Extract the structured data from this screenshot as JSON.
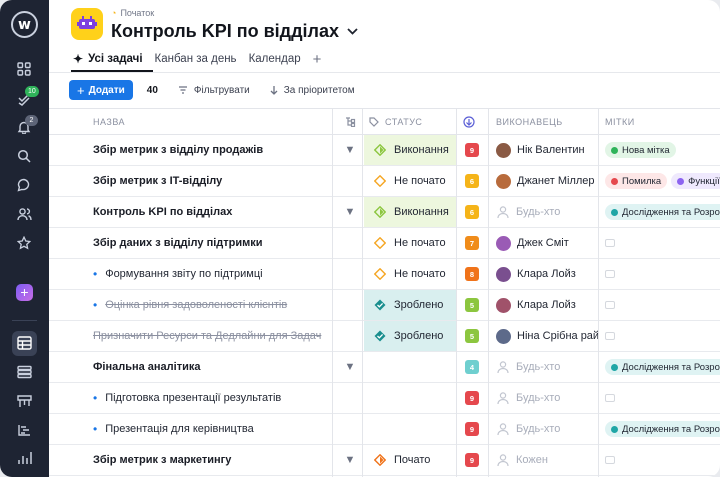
{
  "app": {
    "logo": "w"
  },
  "rail": {
    "badge_tasks": "10",
    "badge_notifications": "2"
  },
  "project": {
    "breadcrumb": "Початок",
    "title": "Контроль KPI по відділах"
  },
  "tabs": [
    {
      "label": "Усі задачі",
      "active": true
    },
    {
      "label": "Канбан за день"
    },
    {
      "label": "Календар"
    }
  ],
  "toolbar": {
    "add_label": "Додати",
    "count": "40",
    "filter_label": "Фільтрувати",
    "sort_label": "За пріоритетом"
  },
  "columns": {
    "name": "НАЗВА",
    "status": "СТАТУС",
    "assignee": "ВИКОНАВЕЦЬ",
    "tags": "МІТКИ"
  },
  "colors": {
    "accent": "#1976e6",
    "rail": "#1e2433",
    "done_green": "#edf7de",
    "done_teal": "#d9efef"
  },
  "rows": [
    {
      "name": "Збір метрик з відділу продажів",
      "level": "parent",
      "chevron": true,
      "status": "Виконання",
      "status_kind": "progress",
      "priority": "9",
      "priority_color": "#e5484d",
      "assignee": "Нік Валентин",
      "tags": [
        {
          "label": "Нова мітка",
          "bg": "#e2f5e6",
          "dot": "#2fb35a"
        }
      ]
    },
    {
      "name": "Збір метрик з IT-відділу",
      "level": "parent",
      "chevron": false,
      "status": "Не почато",
      "status_kind": "todo",
      "priority": "6",
      "priority_color": "#f5b419",
      "assignee": "Джанет Міллер",
      "tags": [
        {
          "label": "Помилка",
          "bg": "#fde7e7",
          "dot": "#e5484d"
        },
        {
          "label": "Функції",
          "bg": "#efe9fd",
          "dot": "#8c63f0"
        }
      ]
    },
    {
      "name": "Контроль KPI по відділах",
      "level": "parent",
      "chevron": true,
      "status": "Виконання",
      "status_kind": "progress",
      "priority": "6",
      "priority_color": "#f5b419",
      "assignee": "Будь-хто",
      "tags": [
        {
          "label": "Дослідження та Розробка",
          "bg": "#dff3f3",
          "dot": "#1fa6a6"
        }
      ]
    },
    {
      "name": "Збір даних з відділу підтримки",
      "level": "parent",
      "chevron": false,
      "status": "Не почато",
      "status_kind": "todo",
      "priority": "7",
      "priority_color": "#f08c1a",
      "assignee": "Джек Сміт",
      "tags": []
    },
    {
      "name": "Формування звіту по підтримці",
      "level": "child",
      "chevron": false,
      "status": "Не почато",
      "status_kind": "todo",
      "priority": "8",
      "priority_color": "#f0731a",
      "assignee": "Клара Лойз",
      "tags": []
    },
    {
      "name": "Оцінка рівня задоволеності клієнтів",
      "level": "child-done",
      "chevron": false,
      "status": "Зроблено",
      "status_kind": "done",
      "priority": "5",
      "priority_color": "#8cc63f",
      "assignee": "Клара Лойз",
      "tags": []
    },
    {
      "name": "Призначити Ресурси та Дедлайни для Задач",
      "level": "done",
      "chevron": false,
      "status": "Зроблено",
      "status_kind": "done",
      "priority": "5",
      "priority_color": "#8cc63f",
      "assignee": "Ніна Срібна райт",
      "tags": []
    },
    {
      "name": "Фінальна аналітика",
      "level": "parent",
      "chevron": true,
      "status": "",
      "status_kind": "none",
      "priority": "4",
      "priority_color": "#6fcfcf",
      "assignee": "Будь-хто",
      "tags": [
        {
          "label": "Дослідження та Розробка",
          "bg": "#dff3f3",
          "dot": "#1fa6a6"
        }
      ]
    },
    {
      "name": "Підготовка презентації результатів",
      "level": "child",
      "chevron": false,
      "status": "",
      "status_kind": "none",
      "priority": "9",
      "priority_color": "#e5484d",
      "assignee": "Будь-хто",
      "tags": []
    },
    {
      "name": "Презентація для керівництва",
      "level": "child",
      "chevron": false,
      "status": "",
      "status_kind": "none",
      "priority": "9",
      "priority_color": "#e5484d",
      "assignee": "Будь-хто",
      "tags": [
        {
          "label": "Дослідження та Розробка",
          "bg": "#dff3f3",
          "dot": "#1fa6a6"
        }
      ]
    },
    {
      "name": "Збір метрик з маркетингу",
      "level": "parent",
      "chevron": true,
      "status": "Почато",
      "status_kind": "started",
      "priority": "9",
      "priority_color": "#e5484d",
      "assignee": "Кожен",
      "tags": []
    }
  ]
}
